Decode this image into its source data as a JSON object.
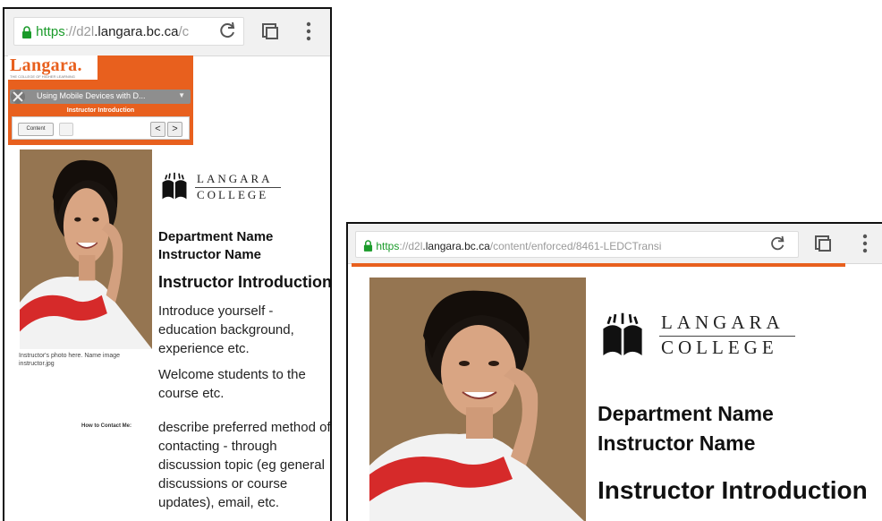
{
  "colors": {
    "accent": "#e8601e",
    "secure": "#1a9b2a"
  },
  "browser": {
    "protocol": "https",
    "separator": "://",
    "host_prefix": "d2l",
    "host": ".langara.bc.ca",
    "path_short": "/c",
    "path_long": "/content/enforced/8461-LEDCTransi",
    "icons": [
      "lock-icon",
      "reload-icon",
      "tabs-icon",
      "menu-icon"
    ]
  },
  "lms": {
    "logo": "Langara.",
    "logo_tagline": "THE COLLEGE OF HIGHER LEARNING",
    "course_name": "Using Mobile Devices with D...",
    "module_title": "Instructor Introduction",
    "content_button": "Content",
    "prev_label": "<",
    "next_label": ">"
  },
  "page": {
    "brand_top": "LANGARA",
    "brand_bottom": "COLLEGE",
    "department": "Department Name",
    "instructor": "Instructor Name",
    "heading": "Instructor Introduction",
    "photo_caption": "Instructor's photo here. Name image instructor.jpg",
    "intro_text": "Introduce yourself - education background, experience etc.",
    "welcome_text": "Welcome students to the course etc.",
    "contact_label": "How to Contact Me:",
    "contact_text": "describe preferred method of contacting - through discussion topic (eg general discussions or course updates), email, etc."
  }
}
